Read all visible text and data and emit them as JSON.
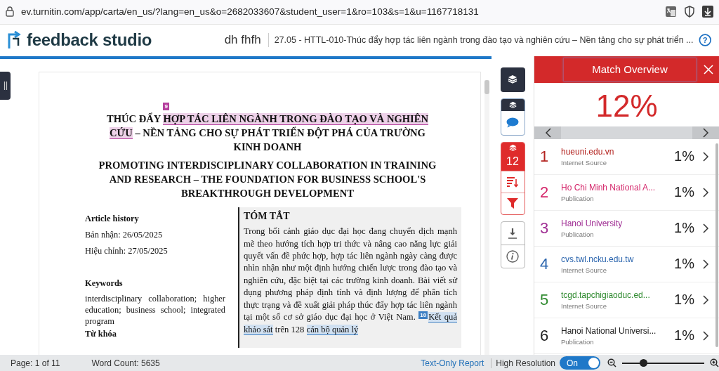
{
  "browser": {
    "url": "ev.turnitin.com/app/carta/en_us/?lang=en_us&o=2682033607&student_user=1&ro=103&s=1&u=1167718131"
  },
  "header": {
    "help": "?",
    "logo": "feedback studio",
    "student": "dh fhfh",
    "title": "27.05 - HTTL-010-Thúc đẩy hợp tác liên ngành trong đào tạo và nghiên cứu – Nền tảng cho sự phát triển ..."
  },
  "document": {
    "title_vi": [
      {
        "text": "THÚC ĐẨY "
      },
      {
        "text": "HỢP TÁC LIÊN NGÀNH TRONG ĐÀO TẠO VÀ NGHIÊN CỨU",
        "match": "9",
        "color": "#b5409e"
      },
      {
        "text": " – NỀN TẢNG CHO SỰ PHÁT TRIỂN ĐỘT PHÁ CỦA TRƯỜNG KINH DOANH"
      }
    ],
    "title_en": "PROMOTING INTERDISCIPLINARY COLLABORATION IN TRAINING AND RESEARCH – THE FOUNDATION FOR BUSINESS SCHOOL'S BREAKTHROUGH DEVELOPMENT",
    "history_heading": "Article history",
    "received": "Bản nhận: 26/05/2025",
    "revised": "Hiệu chỉnh: 27/05/2025",
    "keywords_heading": "Keywords",
    "keywords": "interdisciplinary collaboration; higher education; business school; integrated program",
    "keywords_vi_heading": "Từ khóa",
    "abstract_heading": "TÓM TẮT",
    "abstract": [
      {
        "text": "Trong bối cảnh giáo dục đại học đang chuyển dịch mạnh mẽ theo hướng tích hợp tri thức và nâng cao năng lực giải quyết vấn đề phức hợp, hợp tác liên ngành ngày càng được nhìn nhận như một định hướng chiến lược trong đào tạo và nghiên cứu, đặc biệt tại các trường kinh doanh. Bài viết sử dụng phương pháp định tính và định lượng để phân tích thực trạng và đề xuất giải pháp thúc đẩy hợp tác liên ngành tại một số cơ sở giáo dục đại học ở Việt Nam. "
      },
      {
        "text": "Kết quả khảo sát",
        "match": "10",
        "color": "#3d7fc4"
      },
      {
        "text": " trên 128 "
      },
      {
        "text": "cán bộ quản lý",
        "color": "#3d7fc4"
      }
    ]
  },
  "tools": {
    "match_count": "12"
  },
  "match_panel": {
    "title": "Match Overview",
    "total": "12%",
    "sources": [
      {
        "number": "1",
        "name": "hueuni.edu.vn",
        "type": "Internet Source",
        "percent": "1%",
        "color": "#b3231f"
      },
      {
        "number": "2",
        "name": "Ho Chi Minh National A...",
        "type": "Publication",
        "percent": "1%",
        "color": "#d4266a"
      },
      {
        "number": "3",
        "name": "Hanoi University",
        "type": "Publication",
        "percent": "1%",
        "color": "#a02f94"
      },
      {
        "number": "4",
        "name": "cvs.twl.ncku.edu.tw",
        "type": "Internet Source",
        "percent": "1%",
        "color": "#2a64ad"
      },
      {
        "number": "5",
        "name": "tcgd.tapchigiaoduc.ed...",
        "type": "Internet Source",
        "percent": "1%",
        "color": "#2f8a2f"
      },
      {
        "number": "6",
        "name": "Hanoi National Universi...",
        "type": "Publication",
        "percent": "1%",
        "color": "#222222"
      }
    ]
  },
  "status_bar": {
    "page": "Page: 1 of 11",
    "word_count": "Word Count: 5635",
    "text_only_link": "Text-Only Report",
    "high_resolution_label": "High Resolution",
    "high_resolution": {
      "on": true,
      "label": "On"
    },
    "zoom": {
      "level": 0.26
    }
  }
}
